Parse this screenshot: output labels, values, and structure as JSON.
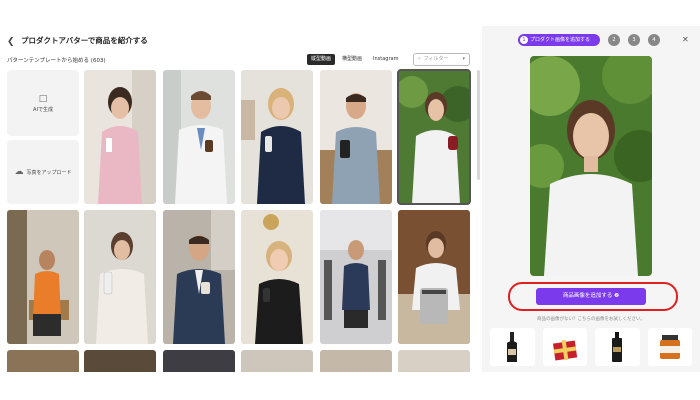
{
  "header": {
    "back_icon": "chevron-left-icon",
    "title": "プロダクトアバターで商品を紹介する"
  },
  "templates": {
    "label": "パターンテンプレートから始める (603)",
    "toggles": [
      {
        "label": "縦型動画",
        "active": true
      },
      {
        "label": "横型動画",
        "active": false
      },
      {
        "label": "Instagram",
        "active": false
      }
    ],
    "filter": {
      "label": "フィルター",
      "icon": "filter-icon"
    }
  },
  "gen_cards": {
    "ai": {
      "label": "AIで生成",
      "icon": "ai-generate-icon"
    },
    "upload": {
      "label": "写真をアップロード",
      "icon": "cloud-upload-icon"
    }
  },
  "steps": [
    {
      "num": "1",
      "label": "プロダクト画像を追加する",
      "active": true
    },
    {
      "num": "2",
      "active": false
    },
    {
      "num": "3",
      "active": false
    },
    {
      "num": "4",
      "active": false
    }
  ],
  "panel": {
    "close_icon": "close-icon",
    "add_button": "商品画像を追加する ❷",
    "hint": "商品の画像がない？こちらの画像をお試しください。"
  },
  "products": [
    "wine-bottle-icon",
    "gift-box-icon",
    "pump-bottle-icon",
    "jar-icon"
  ],
  "colors": {
    "accent": "#7c3aed",
    "highlight": "#e02020"
  }
}
